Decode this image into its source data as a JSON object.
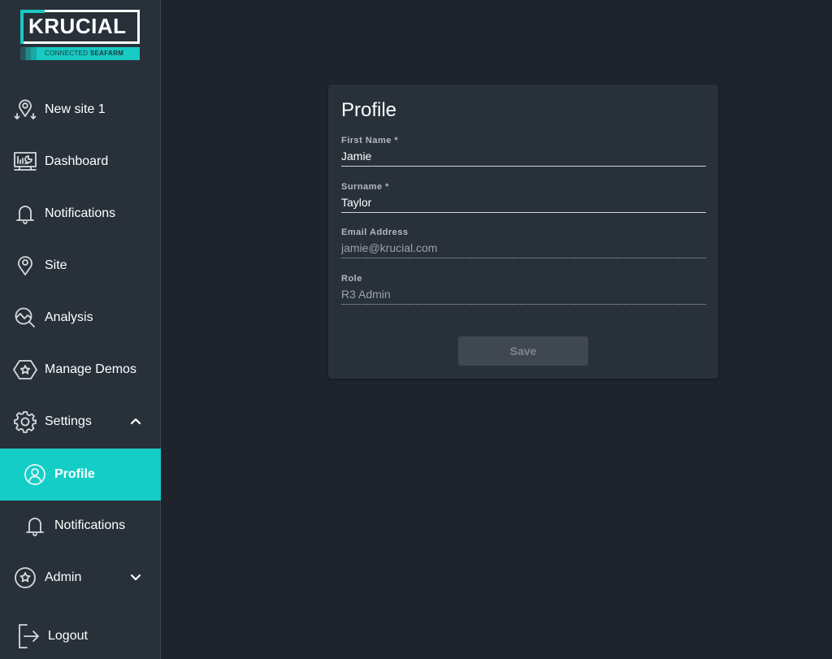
{
  "brand": {
    "name": "KRUCIAL",
    "tagline_light": "CONNECTED",
    "tagline_bold": "SEAFARM",
    "accent_color": "#15cdc7"
  },
  "sidebar": {
    "items": [
      {
        "label": "New site 1",
        "icon": "map-pin-arrows-icon"
      },
      {
        "label": "Dashboard",
        "icon": "monitor-chart-icon"
      },
      {
        "label": "Notifications",
        "icon": "bell-icon"
      },
      {
        "label": "Site",
        "icon": "map-pin-icon"
      },
      {
        "label": "Analysis",
        "icon": "analysis-magnifier-icon"
      },
      {
        "label": "Manage Demos",
        "icon": "hexagon-star-icon"
      },
      {
        "label": "Settings",
        "icon": "gear-icon",
        "expanded": true
      },
      {
        "label": "Profile",
        "icon": "user-circle-icon",
        "active": true
      },
      {
        "label": "Notifications",
        "icon": "bell-icon"
      },
      {
        "label": "Admin",
        "icon": "star-circle-icon",
        "expanded": false
      },
      {
        "label": "Logout",
        "icon": "logout-icon"
      }
    ]
  },
  "profile": {
    "title": "Profile",
    "fields": [
      {
        "label": "First Name *",
        "value": "Jamie",
        "editable": true
      },
      {
        "label": "Surname *",
        "value": "Taylor",
        "editable": true
      },
      {
        "label": "Email Address",
        "value": "jamie@krucial.com",
        "editable": false
      },
      {
        "label": "Role",
        "value": "R3 Admin",
        "editable": false
      }
    ],
    "save_label": "Save"
  }
}
